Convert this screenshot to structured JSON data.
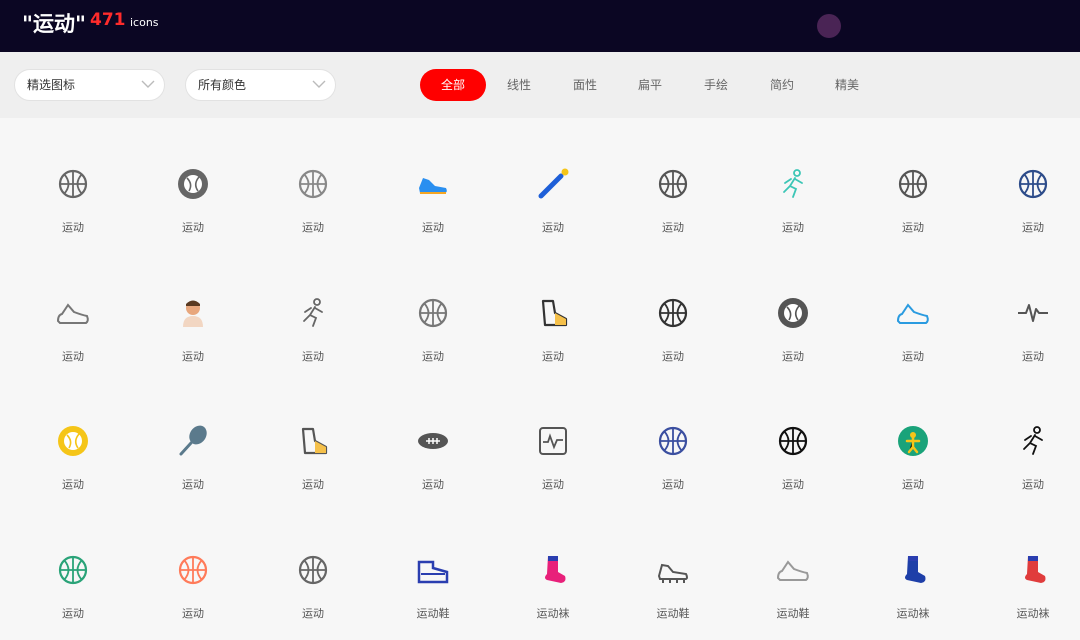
{
  "header": {
    "title": "\"运动\"",
    "count": "471",
    "unit": "icons"
  },
  "filters": {
    "type_select": "精选图标",
    "color_select": "所有颜色"
  },
  "tabs": [
    "全部",
    "线性",
    "面性",
    "扁平",
    "手绘",
    "简约",
    "精美"
  ],
  "active_tab": "全部",
  "icons": [
    {
      "label": "运动",
      "icon": "basketball-icon",
      "color": "#666666"
    },
    {
      "label": "运动",
      "icon": "baseball-filled-icon",
      "color": "#666666"
    },
    {
      "label": "运动",
      "icon": "basketball-outline-icon",
      "color": "#888888"
    },
    {
      "label": "运动",
      "icon": "sneaker-blue-icon",
      "color": "#2a8ff0"
    },
    {
      "label": "运动",
      "icon": "baseball-bat-icon",
      "color": "#1e5fd8"
    },
    {
      "label": "运动",
      "icon": "basketball-icon",
      "color": "#555555"
    },
    {
      "label": "运动",
      "icon": "runner-icon",
      "color": "#3cc6b6"
    },
    {
      "label": "运动",
      "icon": "basketball-bold-icon",
      "color": "#555555"
    },
    {
      "label": "运动",
      "icon": "baseball-blue-icon",
      "color": "#2d4c8a"
    },
    {
      "label": "运动",
      "icon": "shoe-outline-icon",
      "color": "#777777"
    },
    {
      "label": "运动",
      "icon": "athlete-avatar-icon",
      "color": "#e8a77d"
    },
    {
      "label": "运动",
      "icon": "walker-icon",
      "color": "#666666"
    },
    {
      "label": "运动",
      "icon": "basketball-thin-icon",
      "color": "#777777"
    },
    {
      "label": "运动",
      "icon": "boot-icon",
      "color": "#333333"
    },
    {
      "label": "运动",
      "icon": "tennis-ball-outline-icon",
      "color": "#333333"
    },
    {
      "label": "运动",
      "icon": "tennis-ball-filled-icon",
      "color": "#555555"
    },
    {
      "label": "运动",
      "icon": "sneaker-outline-icon",
      "color": "#2a9be0"
    },
    {
      "label": "运动",
      "icon": "heartbeat-icon",
      "color": "#555555"
    },
    {
      "label": "运动",
      "icon": "tennis-ball-yellow-icon",
      "color": "#f5c518"
    },
    {
      "label": "运动",
      "icon": "racket-icon",
      "color": "#5b7a8c"
    },
    {
      "label": "运动",
      "icon": "boot-outline-icon",
      "color": "#555555"
    },
    {
      "label": "运动",
      "icon": "football-icon",
      "color": "#555555"
    },
    {
      "label": "运动",
      "icon": "pulse-monitor-icon",
      "color": "#555555"
    },
    {
      "label": "运动",
      "icon": "basketball-hoop-icon",
      "color": "#3b4fa0"
    },
    {
      "label": "运动",
      "icon": "basketball-black-icon",
      "color": "#111111"
    },
    {
      "label": "运动",
      "icon": "figure-green-icon",
      "color": "#1aa37a"
    },
    {
      "label": "运动",
      "icon": "runner-black-icon",
      "color": "#111111"
    },
    {
      "label": "运动",
      "icon": "baseball-green-icon",
      "color": "#2aa378"
    },
    {
      "label": "运动",
      "icon": "basketball-orange-icon",
      "color": "#ff7b5a"
    },
    {
      "label": "运动",
      "icon": "basketball-gray-icon",
      "color": "#666666"
    },
    {
      "label": "运动鞋",
      "icon": "sneaker-side-blue-icon",
      "color": "#2a3eb0"
    },
    {
      "label": "运动袜",
      "icon": "sock-pink-icon",
      "color": "#e8207a"
    },
    {
      "label": "运动鞋",
      "icon": "cleat-icon",
      "color": "#555555"
    },
    {
      "label": "运动鞋",
      "icon": "sneaker-light-icon",
      "color": "#999999"
    },
    {
      "label": "运动袜",
      "icon": "sock-blue-icon",
      "color": "#1e3fa8"
    },
    {
      "label": "运动袜",
      "icon": "sock-red-icon",
      "color": "#e03c3c"
    }
  ]
}
